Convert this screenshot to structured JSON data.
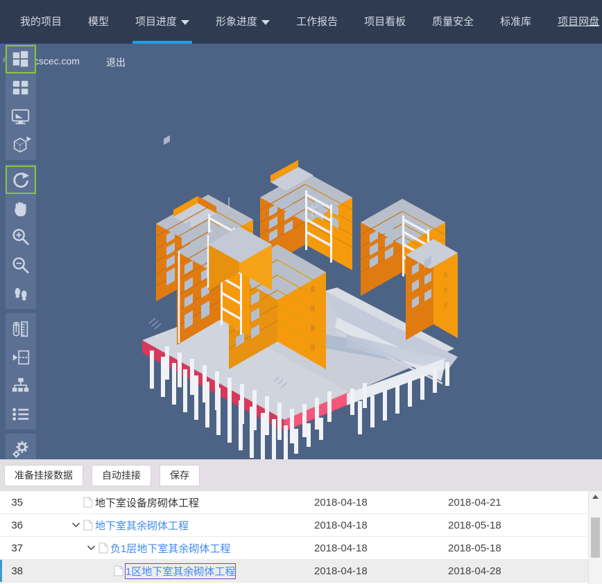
{
  "nav": {
    "items": [
      {
        "label": "我的项目",
        "caret": false,
        "active": false,
        "link": false
      },
      {
        "label": "模型",
        "caret": false,
        "active": false,
        "link": false
      },
      {
        "label": "项目进度",
        "caret": true,
        "active": true,
        "link": false
      },
      {
        "label": "形象进度",
        "caret": true,
        "active": false,
        "link": false
      },
      {
        "label": "工作报告",
        "caret": false,
        "active": false,
        "link": false
      },
      {
        "label": "项目看板",
        "caret": false,
        "active": false,
        "link": false
      },
      {
        "label": "质量安全",
        "caret": false,
        "active": false,
        "link": false
      },
      {
        "label": "标准库",
        "caret": false,
        "active": false,
        "link": false
      },
      {
        "label": "项目网盘",
        "caret": false,
        "active": false,
        "link": true
      }
    ],
    "active_color": "#1e9fe8",
    "bg_color": "#2e3b51"
  },
  "user": {
    "email": "test@cscec.com",
    "logout_label": "退出"
  },
  "viewport": {
    "bg_color": "#4d6385",
    "model_colors": {
      "building": "#f59a0c",
      "building_light": "#fbb040",
      "slab": "#f0476b",
      "column": "#f2f2f4",
      "roof": "#b8bfcb"
    }
  },
  "toolbar": {
    "groups": [
      {
        "buttons": [
          {
            "icon": "windows-grid-icon",
            "selected": true
          },
          {
            "icon": "four-panel-icon",
            "selected": false
          },
          {
            "icon": "monitor-screen-icon",
            "selected": false
          },
          {
            "icon": "box-perspective-icon",
            "selected": false
          }
        ]
      },
      {
        "buttons": [
          {
            "icon": "rotate-icon",
            "selected": true
          },
          {
            "icon": "pan-hand-icon",
            "selected": false
          },
          {
            "icon": "zoom-in-icon",
            "selected": false
          },
          {
            "icon": "zoom-out-icon",
            "selected": false
          },
          {
            "icon": "walk-footsteps-icon",
            "selected": false
          }
        ]
      },
      {
        "buttons": [
          {
            "icon": "measure-ruler-icon",
            "selected": false
          },
          {
            "icon": "section-plane-icon",
            "selected": false
          },
          {
            "icon": "hierarchy-tree-icon",
            "selected": false
          },
          {
            "icon": "list-items-icon",
            "selected": false
          }
        ]
      },
      {
        "buttons": [
          {
            "icon": "settings-gears-icon",
            "selected": false
          }
        ]
      }
    ],
    "home_icon": "home-icon",
    "selected_border_color": "#8ac53e",
    "bg_color": "#5b7093"
  },
  "actions": {
    "buttons": [
      {
        "label": "准备挂接数据"
      },
      {
        "label": "自动挂接"
      },
      {
        "label": "保存"
      }
    ]
  },
  "table": {
    "rows": [
      {
        "index": "35",
        "name": "地下室设备房砌体工程",
        "indent": 2,
        "expandable": false,
        "style": "plain",
        "start_date": "2018-04-18",
        "end_date": "2018-04-21",
        "selected": false
      },
      {
        "index": "36",
        "name": "地下室其余砌体工程",
        "indent": 2,
        "expandable": true,
        "style": "link",
        "start_date": "2018-04-18",
        "end_date": "2018-05-18",
        "selected": false
      },
      {
        "index": "37",
        "name": "负1层地下室其余砌体工程",
        "indent": 3,
        "expandable": true,
        "style": "link",
        "start_date": "2018-04-18",
        "end_date": "2018-05-18",
        "selected": false
      },
      {
        "index": "38",
        "name": "1区地下室其余砌体工程",
        "indent": 4,
        "expandable": false,
        "style": "focus",
        "start_date": "2018-04-18",
        "end_date": "2018-04-28",
        "selected": true
      }
    ]
  },
  "scrollbar": {
    "up_arrow": "scroll-up-arrow-icon"
  }
}
